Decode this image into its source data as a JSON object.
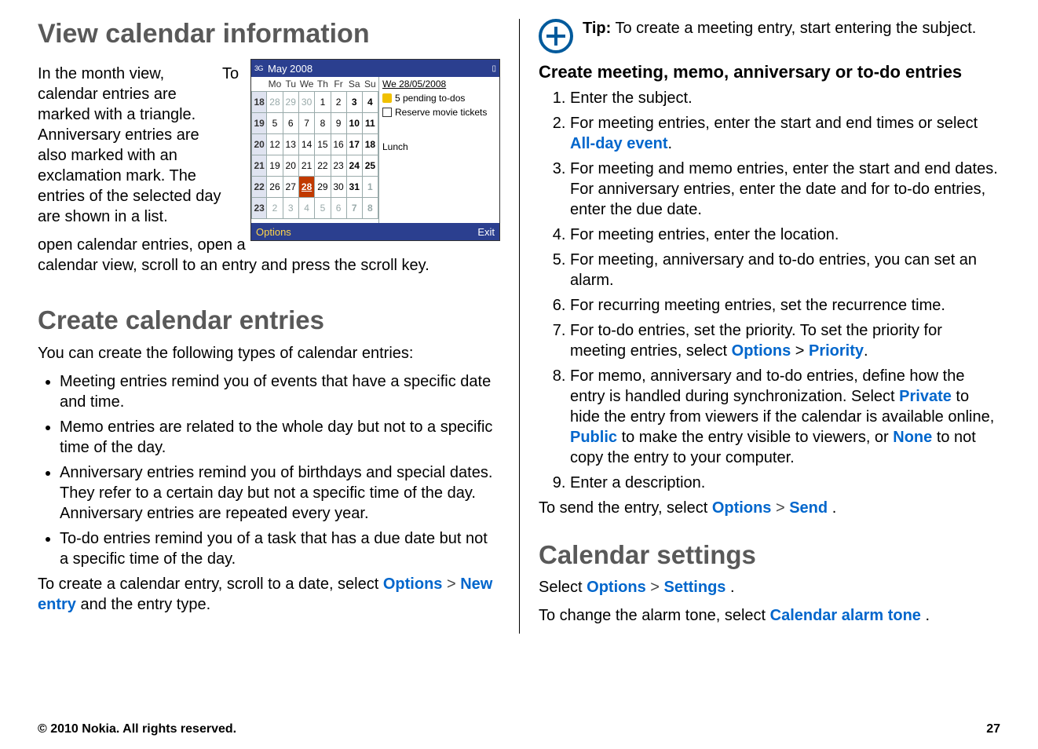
{
  "left": {
    "h1": "View calendar information",
    "p1": "In the month view, calendar entries are marked with a triangle. Anniversary entries are also marked with an exclamation mark. The entries of the selected day are shown in a list.",
    "p2": "To open calendar entries, open a calendar view, scroll to an entry and press the scroll key.",
    "h2a": "Create calendar entries",
    "p3": "You can create the following types of calendar entries:",
    "bullets": [
      "Meeting entries remind you of events that have a specific date and time.",
      "Memo entries are related to the whole day but not to a specific time of the day.",
      "Anniversary entries remind you of birthdays and special dates. They refer to a certain day but not a specific time of the day. Anniversary entries are repeated every year.",
      "To-do entries remind you of a task that has a due date but not a specific time of the day."
    ],
    "p4a": "To create a calendar entry, scroll to a date, select ",
    "p4_opt": "Options",
    "p4_gt": " > ",
    "p4_new": "New entry",
    "p4b": " and the entry type."
  },
  "screenshot": {
    "signal": "3G",
    "title": "May 2008",
    "days": [
      "Mo",
      "Tu",
      "We",
      "Th",
      "Fr",
      "Sa",
      "Su"
    ],
    "weeks": [
      "18",
      "19",
      "20",
      "21",
      "22",
      "23"
    ],
    "grid": [
      [
        "28",
        "29",
        "30",
        "1",
        "2",
        "3",
        "4"
      ],
      [
        "5",
        "6",
        "7",
        "8",
        "9",
        "10",
        "11"
      ],
      [
        "12",
        "13",
        "14",
        "15",
        "16",
        "17",
        "18"
      ],
      [
        "19",
        "20",
        "21",
        "22",
        "23",
        "24",
        "25"
      ],
      [
        "26",
        "27",
        "28",
        "29",
        "30",
        "31",
        "1"
      ],
      [
        "2",
        "3",
        "4",
        "5",
        "6",
        "7",
        "8"
      ]
    ],
    "side_date": "We 28/05/2008",
    "side_todo": "5 pending to-dos",
    "side_item1": "Reserve movie tickets",
    "side_item2": "Lunch",
    "softleft": "Options",
    "softright": "Exit"
  },
  "right": {
    "tip_label": "Tip:",
    "tip_text": " To create a meeting entry, start entering the subject.",
    "subhead": "Create meeting, memo, anniversary or to-do entries",
    "steps": [
      {
        "t": "Enter the subject."
      },
      {
        "pre": "For meeting entries, enter the start and end times or select ",
        "kw": "All-day event",
        "post": "."
      },
      {
        "t": "For meeting and memo entries, enter the start and end dates. For anniversary entries, enter the date and for to-do entries, enter the due date."
      },
      {
        "t": "For meeting entries, enter the location."
      },
      {
        "t": "For meeting, anniversary and to-do entries, you can set an alarm."
      },
      {
        "t": "For recurring meeting entries, set the recurrence time."
      },
      {
        "pre": "For to-do entries, set the priority. To set the priority for meeting entries, select ",
        "kw": "Options",
        "mid": " > ",
        "kw2": "Priority",
        "post": "."
      },
      {
        "pre": "For memo, anniversary and to-do entries, define how the entry is handled during synchronization. Select ",
        "kw": "Private",
        "mid": " to hide the entry from viewers if the calendar is available online, ",
        "kw2": "Public",
        "mid2": " to make the entry visible to viewers, or ",
        "kw3": "None",
        "post": " to not copy the entry to your computer."
      },
      {
        "t": "Enter a description."
      }
    ],
    "send_pre": "To send the entry, select ",
    "send_opt": "Options",
    "send_gt": " > ",
    "send_kw": "Send",
    "send_post": ".",
    "h2b": "Calendar settings",
    "set_pre": "Select ",
    "set_opt": "Options",
    "set_gt": " > ",
    "set_kw": "Settings",
    "set_post": ".",
    "alarm_pre": "To change the alarm tone, select ",
    "alarm_kw": "Calendar alarm tone",
    "alarm_post": "."
  },
  "footer": {
    "copyright": "© 2010 Nokia. All rights reserved.",
    "page": "27"
  }
}
